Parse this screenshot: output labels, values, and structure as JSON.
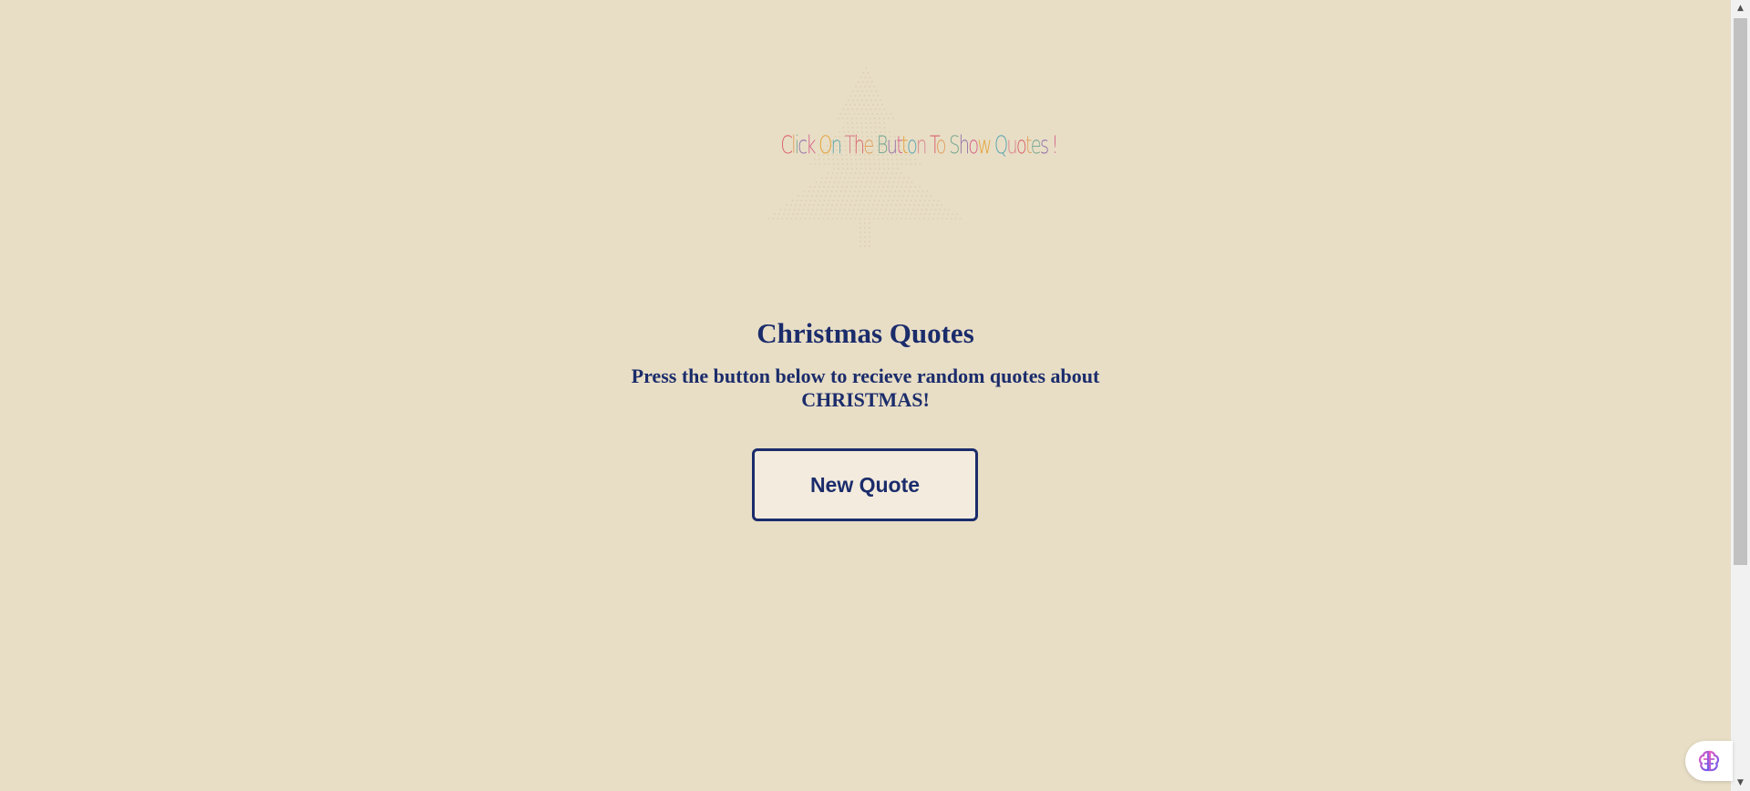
{
  "banner": {
    "text": "Click On The Button To Show Quotes !",
    "letter_colors": [
      "#d9646e",
      "#e0a060",
      "#7aa892",
      "#9370a8",
      "#d6658c",
      "#e5a33c",
      "#5fa7b0",
      "#d9828c"
    ]
  },
  "main": {
    "title": "Christmas Quotes",
    "subtitle": "Press the button below to recieve random quotes about CHRISTMAS!",
    "button_label": "New Quote"
  },
  "scrollbar": {
    "up_arrow": "▲",
    "down_arrow": "▼"
  },
  "helper_widget": {
    "icon": "brain-icon"
  },
  "colors": {
    "background": "#e8dec6",
    "text": "#1b2c6b",
    "button_bg": "#f3ebdd"
  }
}
